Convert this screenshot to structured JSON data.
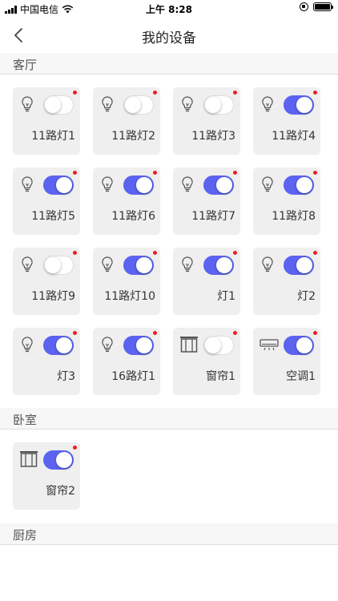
{
  "status_bar": {
    "carrier": "中国电信",
    "time": "上午 8:28"
  },
  "nav": {
    "title": "我的设备"
  },
  "colors": {
    "toggle_on": "#5b63f0",
    "badge": "#ee1c24",
    "card_bg": "#efefef"
  },
  "sections": [
    {
      "title": "客厅",
      "devices": [
        {
          "label": "11路灯1",
          "icon": "bulb-icon",
          "on": false
        },
        {
          "label": "11路灯2",
          "icon": "bulb-icon",
          "on": false
        },
        {
          "label": "11路灯3",
          "icon": "bulb-icon",
          "on": false
        },
        {
          "label": "11路灯4",
          "icon": "bulb-icon",
          "on": true
        },
        {
          "label": "11路灯5",
          "icon": "bulb-icon",
          "on": true
        },
        {
          "label": "11路灯6",
          "icon": "bulb-icon",
          "on": true
        },
        {
          "label": "11路灯7",
          "icon": "bulb-icon",
          "on": true
        },
        {
          "label": "11路灯8",
          "icon": "bulb-icon",
          "on": true
        },
        {
          "label": "11路灯9",
          "icon": "bulb-icon",
          "on": false
        },
        {
          "label": "11路灯10",
          "icon": "bulb-icon",
          "on": true
        },
        {
          "label": "灯1",
          "icon": "bulb-icon",
          "on": true
        },
        {
          "label": "灯2",
          "icon": "bulb-icon",
          "on": true
        },
        {
          "label": "灯3",
          "icon": "bulb-icon",
          "on": true
        },
        {
          "label": "16路灯1",
          "icon": "bulb-icon",
          "on": true
        },
        {
          "label": "窗帘1",
          "icon": "curtain-icon",
          "on": false
        },
        {
          "label": "空调1",
          "icon": "air-conditioner-icon",
          "on": true
        }
      ]
    },
    {
      "title": "卧室",
      "devices": [
        {
          "label": "窗帘2",
          "icon": "curtain-icon",
          "on": true
        }
      ]
    },
    {
      "title": "厨房",
      "devices": []
    }
  ]
}
